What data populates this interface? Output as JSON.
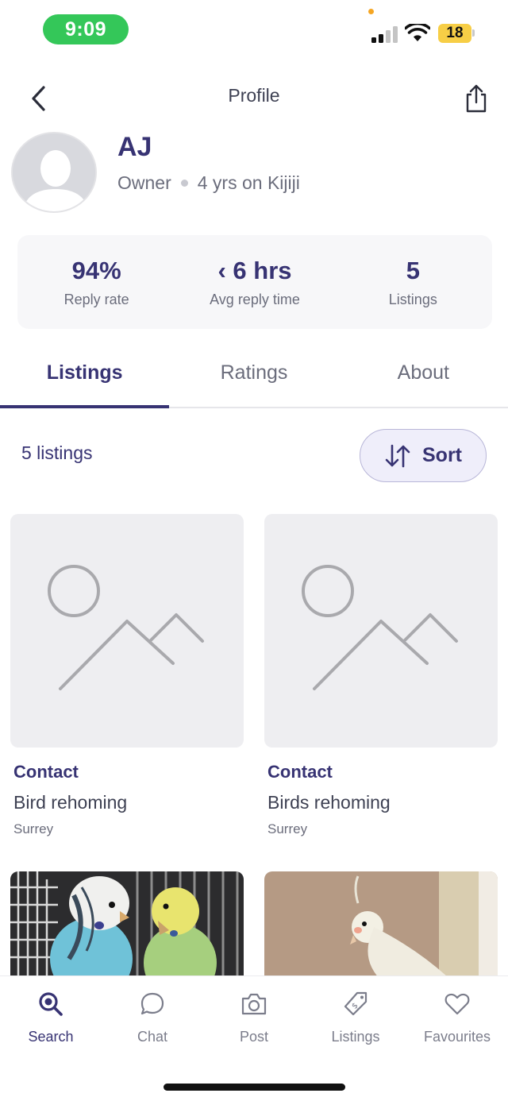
{
  "status_bar": {
    "time": "9:09",
    "battery": "18"
  },
  "header": {
    "title": "Profile"
  },
  "profile": {
    "name": "AJ",
    "role": "Owner",
    "tenure": "4 yrs on Kijiji"
  },
  "stats": [
    {
      "value": "94%",
      "label": "Reply rate"
    },
    {
      "value": "‹ 6 hrs",
      "label": "Avg reply time"
    },
    {
      "value": "5",
      "label": "Listings"
    }
  ],
  "tabs": [
    {
      "label": "Listings",
      "active": true
    },
    {
      "label": "Ratings",
      "active": false
    },
    {
      "label": "About",
      "active": false
    }
  ],
  "listings_bar": {
    "count": "5 listings",
    "sort_label": "Sort"
  },
  "listings": [
    {
      "price": "Contact",
      "title": "Bird rehoming",
      "location": "Surrey",
      "image": "placeholder-image-icon"
    },
    {
      "price": "Contact",
      "title": "Birds rehoming",
      "location": "Surrey",
      "image": "placeholder-image-icon"
    },
    {
      "image": "budgie-photo"
    },
    {
      "image": "cockatiel-photo"
    }
  ],
  "bottom_nav": [
    {
      "label": "Search",
      "icon": "search-icon",
      "active": true
    },
    {
      "label": "Chat",
      "icon": "chat-icon",
      "active": false
    },
    {
      "label": "Post",
      "icon": "camera-icon",
      "active": false
    },
    {
      "label": "Listings",
      "icon": "price-tag-icon",
      "active": false
    },
    {
      "label": "Favourites",
      "icon": "heart-icon",
      "active": false
    }
  ],
  "colors": {
    "brand": "#373373",
    "accent_green": "#34c759",
    "sort_bg": "#efeefa"
  }
}
